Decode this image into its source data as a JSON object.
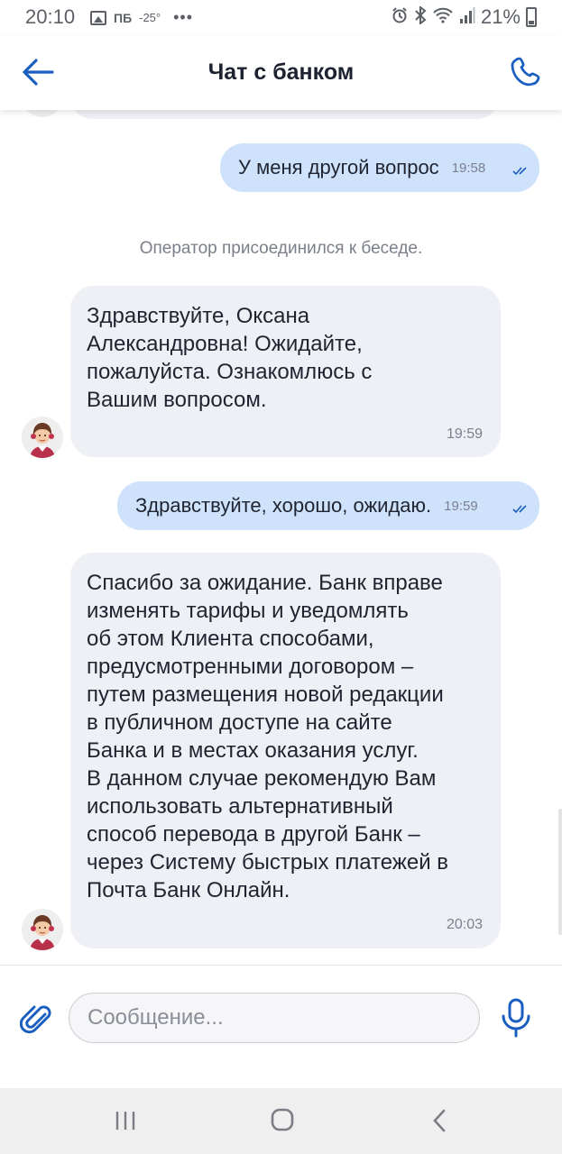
{
  "status_bar": {
    "time": "20:10",
    "carrier": "ПБ",
    "temperature": "-25°",
    "overflow": "•••",
    "battery_percent": "21%",
    "icons": [
      "image-icon",
      "alarm-icon",
      "bluetooth-icon",
      "wifi-icon",
      "signal-icon",
      "battery-icon"
    ]
  },
  "header": {
    "title": "Чат с банком",
    "back_icon": "arrow-left-icon",
    "call_icon": "phone-icon"
  },
  "messages": [
    {
      "type": "outgoing",
      "text": "У меня другой вопрос",
      "time": "19:58",
      "status": "read"
    },
    {
      "type": "system",
      "text": "Оператор присоединился к беседе."
    },
    {
      "type": "incoming",
      "lines": [
        "Здравствуйте, Оксана",
        "Александровна! Ожидайте,",
        "пожалуйста. Ознакомлюсь с",
        "Вашим вопросом."
      ],
      "time": "19:59"
    },
    {
      "type": "outgoing",
      "text": "Здравствуйте, хорошо, ожидаю.",
      "time": "19:59",
      "status": "read"
    },
    {
      "type": "incoming",
      "lines": [
        "Спасибо за ожидание. Банк вправе",
        "изменять тарифы и уведомлять",
        "об этом Клиента способами,",
        "предусмотренными договором –",
        "путем размещения новой редакции",
        "в публичном доступе на сайте",
        "Банка и в местах оказания услуг.",
        "В данном случае рекомендую Вам",
        "использовать альтернативный",
        "способ перевода в другой Банк –",
        "через Систему быстрых платежей в",
        "Почта Банк Онлайн."
      ],
      "time": "20:03"
    }
  ],
  "composer": {
    "placeholder": "Сообщение...",
    "value": "",
    "attach_icon": "paperclip-icon",
    "mic_icon": "microphone-icon"
  },
  "nav": {
    "recent_icon": "recent-apps-icon",
    "home_icon": "home-icon",
    "back_icon": "back-icon"
  },
  "colors": {
    "accent": "#1a5ec0",
    "outgoing_bubble": "#cfe2fb",
    "incoming_bubble": "#eff0f5",
    "nav_bar": "#efefef"
  }
}
